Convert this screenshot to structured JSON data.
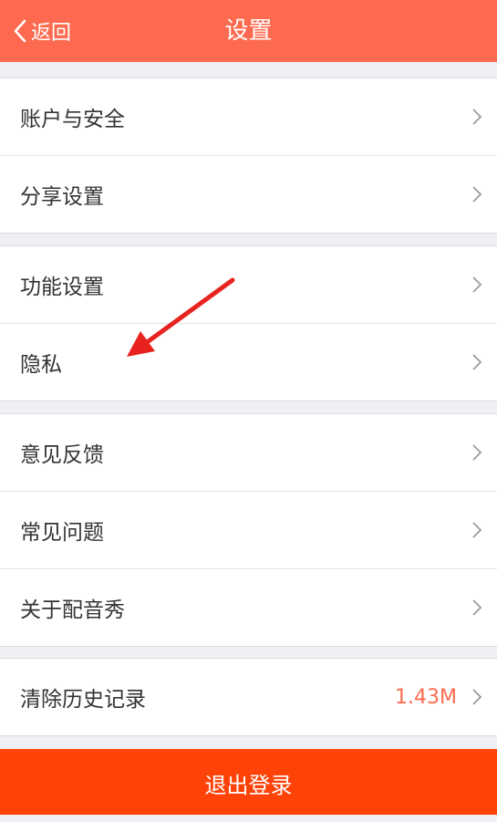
{
  "header": {
    "back_label": "返回",
    "title": "设置"
  },
  "groups": [
    {
      "items": [
        {
          "label": "账户与安全"
        },
        {
          "label": "分享设置"
        }
      ]
    },
    {
      "items": [
        {
          "label": "功能设置"
        },
        {
          "label": "隐私"
        }
      ]
    },
    {
      "items": [
        {
          "label": "意见反馈"
        },
        {
          "label": "常见问题"
        },
        {
          "label": "关于配音秀"
        }
      ]
    },
    {
      "items": [
        {
          "label": "清除历史记录",
          "value": "1.43M"
        }
      ]
    }
  ],
  "logout_label": "退出登录",
  "colors": {
    "header_bg": "#fe6a4f",
    "logout_bg": "#ff4308",
    "annotation_arrow": "#e8231f",
    "cache_value": "#fe6a4f"
  }
}
